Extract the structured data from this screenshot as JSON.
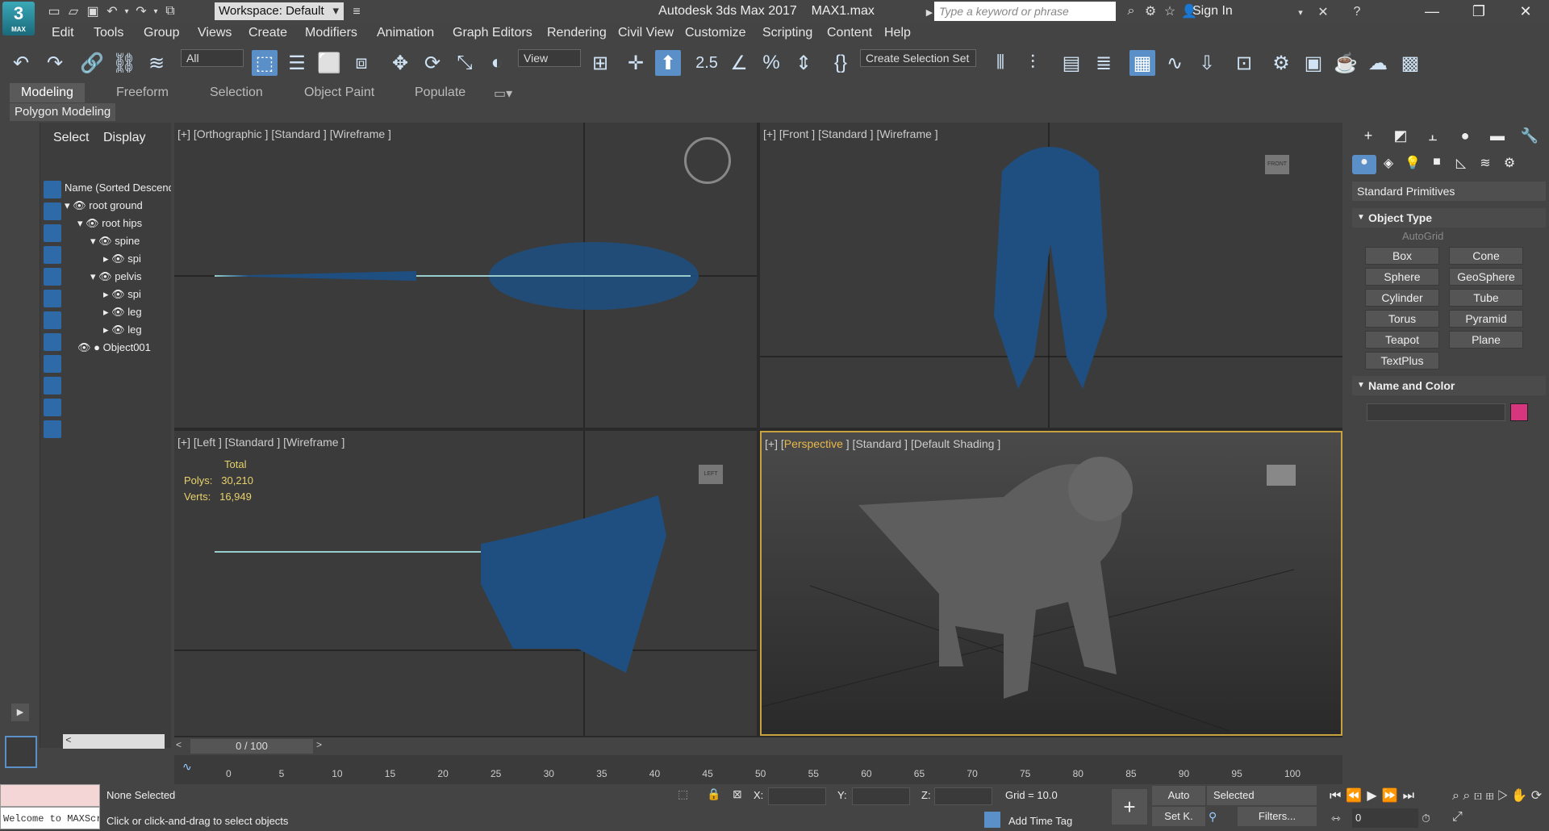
{
  "app": {
    "title": "Autodesk 3ds Max 2017",
    "file": "MAX1.max",
    "logo_text": "3",
    "logo_sub": "MAX"
  },
  "titlebar": {
    "workspace_label": "Workspace: Default",
    "search_placeholder": "Type a keyword or phrase",
    "signin_label": "Sign In"
  },
  "menu": [
    "Edit",
    "Tools",
    "Group",
    "Views",
    "Create",
    "Modifiers",
    "Animation",
    "Graph Editors",
    "Rendering",
    "Civil View",
    "Customize",
    "Scripting",
    "Content",
    "Help"
  ],
  "toolbar": {
    "selection_filter": "All",
    "ref_coord": "View",
    "snap_label": "2.5",
    "named_selection": "Create Selection Set"
  },
  "ribbon": {
    "tabs": [
      "Modeling",
      "Freeform",
      "Selection",
      "Object Paint",
      "Populate"
    ],
    "panel_label": "Polygon Modeling"
  },
  "scene_explorer": {
    "tabs": [
      "Select",
      "Display"
    ],
    "column_header": "Name (Sorted Descending)",
    "rows": [
      {
        "name": "root ground",
        "indent": 0
      },
      {
        "name": "root hips",
        "indent": 1
      },
      {
        "name": "spine",
        "indent": 2
      },
      {
        "name": "spi",
        "indent": 3
      },
      {
        "name": "pelvis",
        "indent": 2
      },
      {
        "name": "spi",
        "indent": 3
      },
      {
        "name": "leg",
        "indent": 3
      },
      {
        "name": "leg",
        "indent": 3
      },
      {
        "name": "Object001",
        "indent": 0
      }
    ]
  },
  "viewports": {
    "top_left": "[+] [Orthographic ] [Standard ] [Wireframe ]",
    "top_right": "[+] [Front ] [Standard ] [Wireframe ]",
    "bottom_left": "[+] [Left ] [Standard ] [Wireframe ]",
    "bottom_right_prefix": "[+] [",
    "bottom_right_view": "Perspective",
    "bottom_right_suffix": " ] [Standard ] [Default Shading ]",
    "stats": {
      "total_label": "Total",
      "polys_label": "Polys:",
      "polys_value": "30,210",
      "verts_label": "Verts:",
      "verts_value": "16,949"
    },
    "viewcube_front": "FRONT",
    "viewcube_left": "LEFT"
  },
  "command_panel": {
    "category": "Standard Primitives",
    "object_type_label": "Object Type",
    "autogrid_label": "AutoGrid",
    "buttons": [
      "Box",
      "Cone",
      "Sphere",
      "GeoSphere",
      "Cylinder",
      "Tube",
      "Torus",
      "Pyramid",
      "Teapot",
      "Plane",
      "TextPlus"
    ],
    "name_color_label": "Name and Color",
    "name_color": "#d6367e"
  },
  "timeline": {
    "slider_label": "0 / 100",
    "ticks": [
      "0",
      "5",
      "10",
      "15",
      "20",
      "25",
      "30",
      "35",
      "40",
      "45",
      "50",
      "55",
      "60",
      "65",
      "70",
      "75",
      "80",
      "85",
      "90",
      "95",
      "100"
    ]
  },
  "status": {
    "selection": "None Selected",
    "prompt": "Click or click-and-drag to select objects",
    "listener_text": "Welcome to MAXScript.",
    "x_label": "X:",
    "y_label": "Y:",
    "z_label": "Z:",
    "grid": "Grid = 10.0",
    "add_time_tag": "Add Time Tag",
    "auto_key": "Auto",
    "set_key": "Set K.",
    "key_filter": "Selected",
    "filters": "Filters...",
    "frame": "0"
  }
}
